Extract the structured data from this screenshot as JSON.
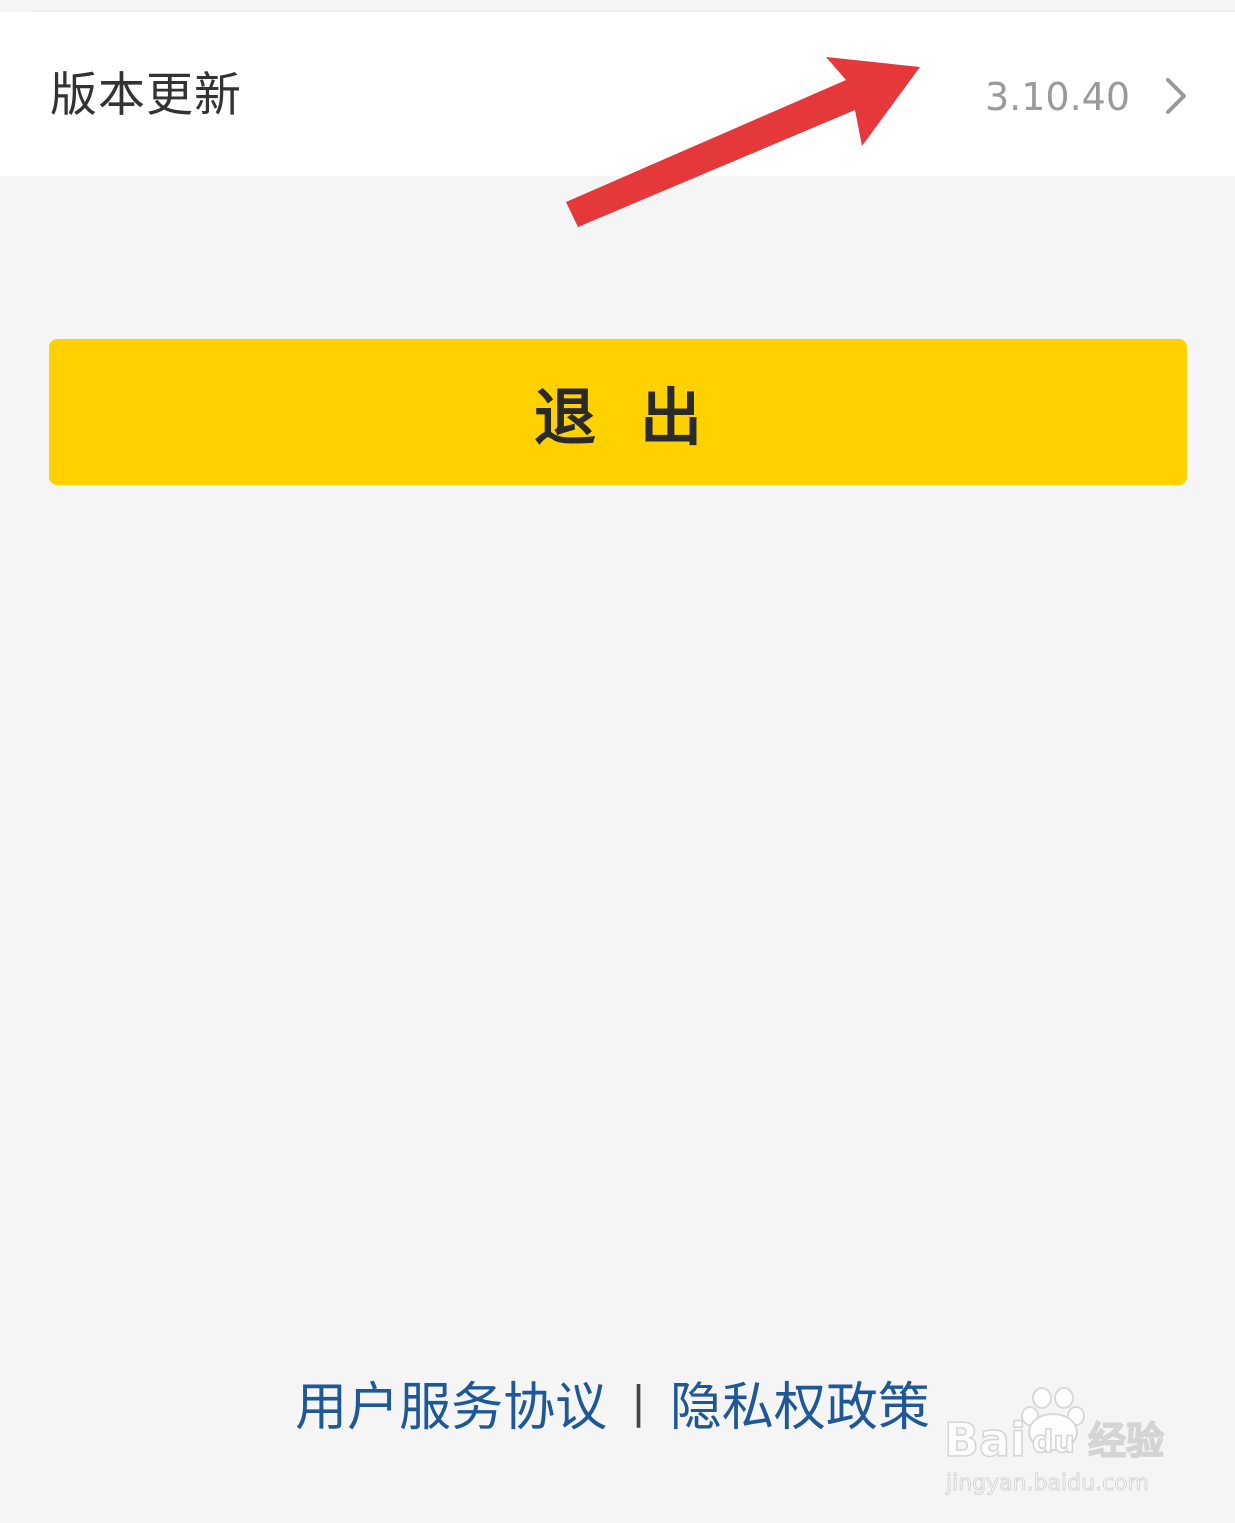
{
  "settings": {
    "version_row": {
      "label": "版本更新",
      "value": "3.10.40",
      "chevron_icon": "chevron-right-icon"
    }
  },
  "annotation": {
    "arrow_icon": "red-arrow-icon",
    "color": "#e5383b"
  },
  "logout": {
    "label": "退出",
    "color": "#ffd100"
  },
  "footer": {
    "user_agreement": "用户服务协议",
    "separator": "|",
    "privacy_policy": "隐私权政策",
    "link_color": "#1e5897"
  },
  "watermark": {
    "brand": "Baidu经验",
    "url": "jingyan.baidu.com"
  }
}
